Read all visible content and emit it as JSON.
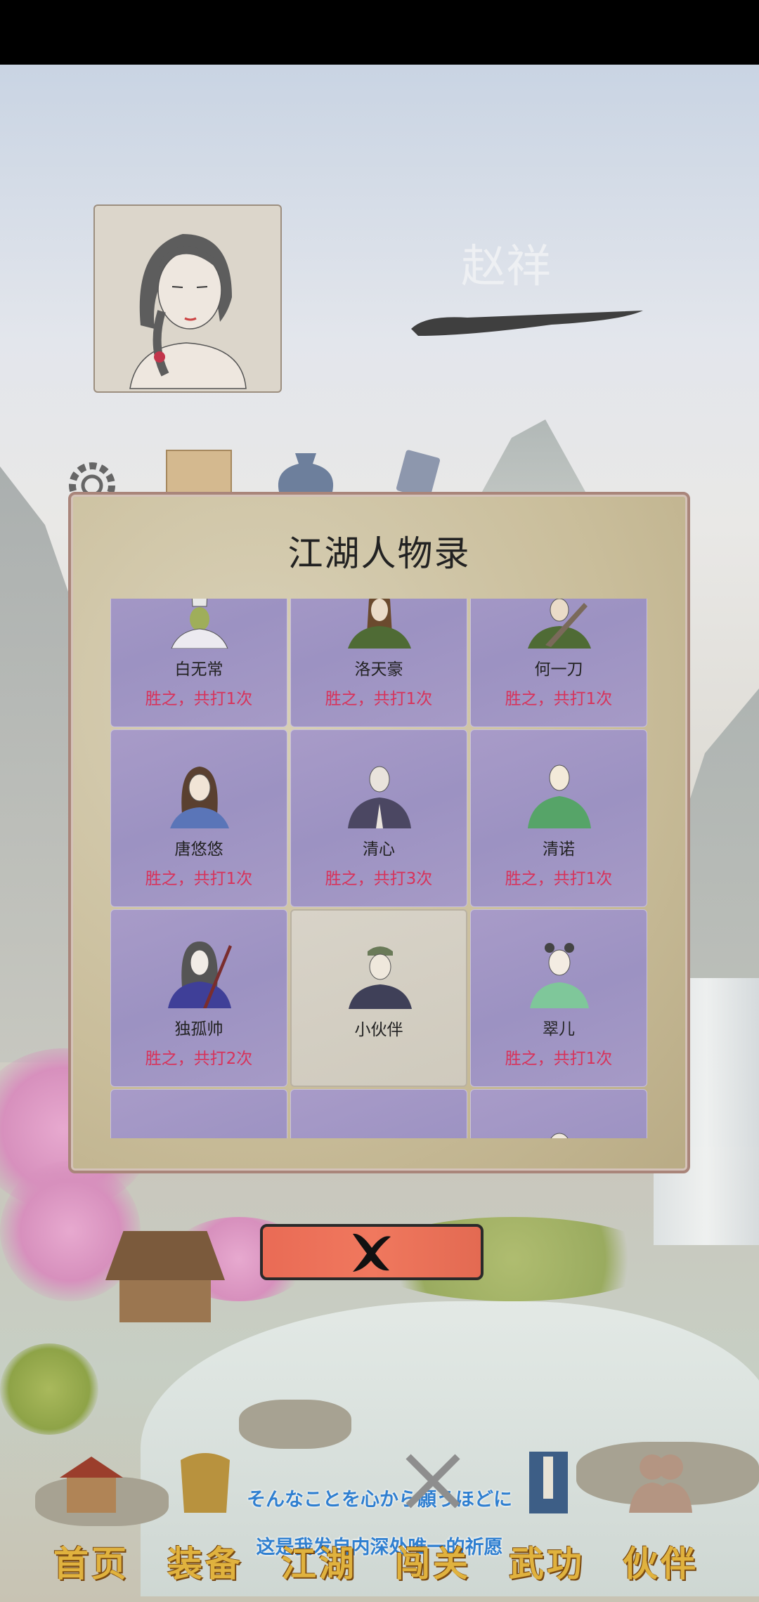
{
  "player": {
    "name": "赵祥"
  },
  "modal": {
    "title": "江湖人物录",
    "characters": [
      {
        "name": "白无常",
        "record": "胜之，共打1次"
      },
      {
        "name": "洛天豪",
        "record": "胜之，共打1次"
      },
      {
        "name": "何一刀",
        "record": "胜之，共打1次"
      },
      {
        "name": "唐悠悠",
        "record": "胜之，共打1次"
      },
      {
        "name": "清心",
        "record": "胜之，共打3次"
      },
      {
        "name": "清诺",
        "record": "胜之，共打1次"
      },
      {
        "name": "独孤帅",
        "record": "胜之，共打2次"
      },
      {
        "name": "小伙伴",
        "record": ""
      },
      {
        "name": "翠儿",
        "record": "胜之，共打1次"
      }
    ]
  },
  "bottom_nav": {
    "items": [
      {
        "label": "首页",
        "icon": "house-icon"
      },
      {
        "label": "装备",
        "icon": "armor-icon"
      },
      {
        "label": "江湖",
        "icon": "world-icon"
      },
      {
        "label": "闯关",
        "icon": "swords-icon"
      },
      {
        "label": "武功",
        "icon": "book-icon"
      },
      {
        "label": "伙伴",
        "icon": "partners-icon"
      }
    ]
  },
  "subtitles": {
    "line1": "そんなことを心から願うほどに",
    "line2": "这是我发自内深处唯一的祈愿"
  },
  "colors": {
    "record_text": "#d8325a",
    "close_button": "#ee735a",
    "nav_label": "#e0b23e"
  }
}
